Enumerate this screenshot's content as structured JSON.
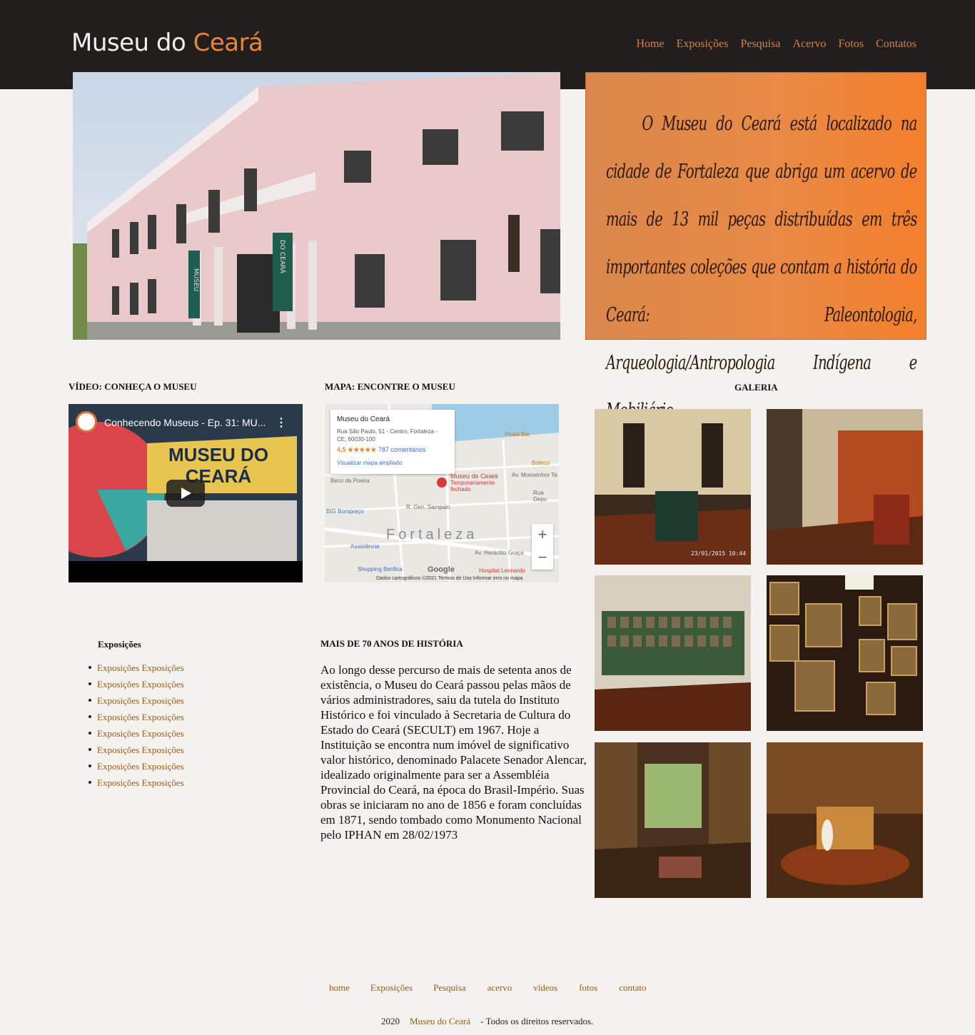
{
  "header": {
    "logo_main": "Museu do ",
    "logo_accent": "Ceará",
    "nav": [
      "Home",
      "Exposições",
      "Pesquisa",
      "Acervo",
      "Fotos",
      "Contatos"
    ]
  },
  "hero": {
    "banner_left": "MUSEU",
    "banner_right": "DO CEARÁ"
  },
  "quote": "O Museu do Ceará está localizado na cidade de Fortaleza que abriga um acervo de mais de 13 mil peças distribuídas em três importantes coleções que contam a história do Ceará: Paleontologia, Arqueologia/Antropologia Indígena e Mobiliário.",
  "sections": {
    "video_heading": "VÍDEO: CONHEÇA O MUSEU",
    "map_heading": "MAPA: ENCONTRE O MUSEU",
    "gallery_heading": "GALERIA",
    "history_heading": "MAIS DE 70 ANOS DE HISTÓRIA"
  },
  "video": {
    "title": "Conhecendo Museus - Ep. 31: MU...",
    "banner_line1": "MUSEU DO",
    "banner_line2": "CEARÁ"
  },
  "map": {
    "place": "Museu do Ceará",
    "address": "Rua São Paulo, 51 - Centro, Fortaleza - CE, 60030-100",
    "rating": "4,5 ★★★★★",
    "reviews": "787 comentários",
    "link": "Visualizar mapa ampliado",
    "city": "Fortaleza",
    "pin_label": "Museu do Ceará",
    "pin_status": "Temporariamente fechado",
    "labels": [
      "Pirata Bar",
      "Boteco",
      "Beco da Poeira",
      "Av. Monsenhor Ta",
      "Rua Depu",
      "BIG Bompreço",
      "R. Gen. Sampaio",
      "Av. Heráclito Graça",
      "Assistência",
      "Shopping Benfica",
      "Hospital Leonardo"
    ],
    "google": "Google",
    "footer": "Dados cartográficos ©2021    Termos de Uso    Informar erro no mapa"
  },
  "exposicoes": {
    "title": "Exposições",
    "items": [
      "Exposições Exposições",
      "Exposições Exposições",
      "Exposições Exposições",
      "Exposições Exposições",
      "Exposições Exposições",
      "Exposições Exposições",
      "Exposições Exposições",
      "Exposições Exposições"
    ]
  },
  "history": "Ao longo desse percurso de mais de setenta anos de existência, o Museu do Ceará passou pelas mãos de vários administradores, saiu da tutela do Instituto Histórico e foi vinculado à Secretaria de Cultura do Estado do Ceará (SECULT) em 1967. Hoje a Instituição se encontra num imóvel de significativo valor histórico, denominado Palacete Senador Alencar, idealizado originalmente para ser a Assembléia Provincial do Ceará, na época do Brasil-Império. Suas obras se iniciaram no ano de 1856 e foram concluídas em 1871, sendo tombado como Monumento Nacional pelo IPHAN em 28/02/1973",
  "gallery": {
    "stamp": "23/01/2015 10:44"
  },
  "footer": {
    "links": [
      "home",
      "Exposições",
      "Pesquisa",
      "acervo",
      "vídeos",
      "fotos",
      "contato"
    ],
    "year": "2020",
    "brand": "Museu do Ceará",
    "rights": "- Todos os direitos reservados."
  }
}
